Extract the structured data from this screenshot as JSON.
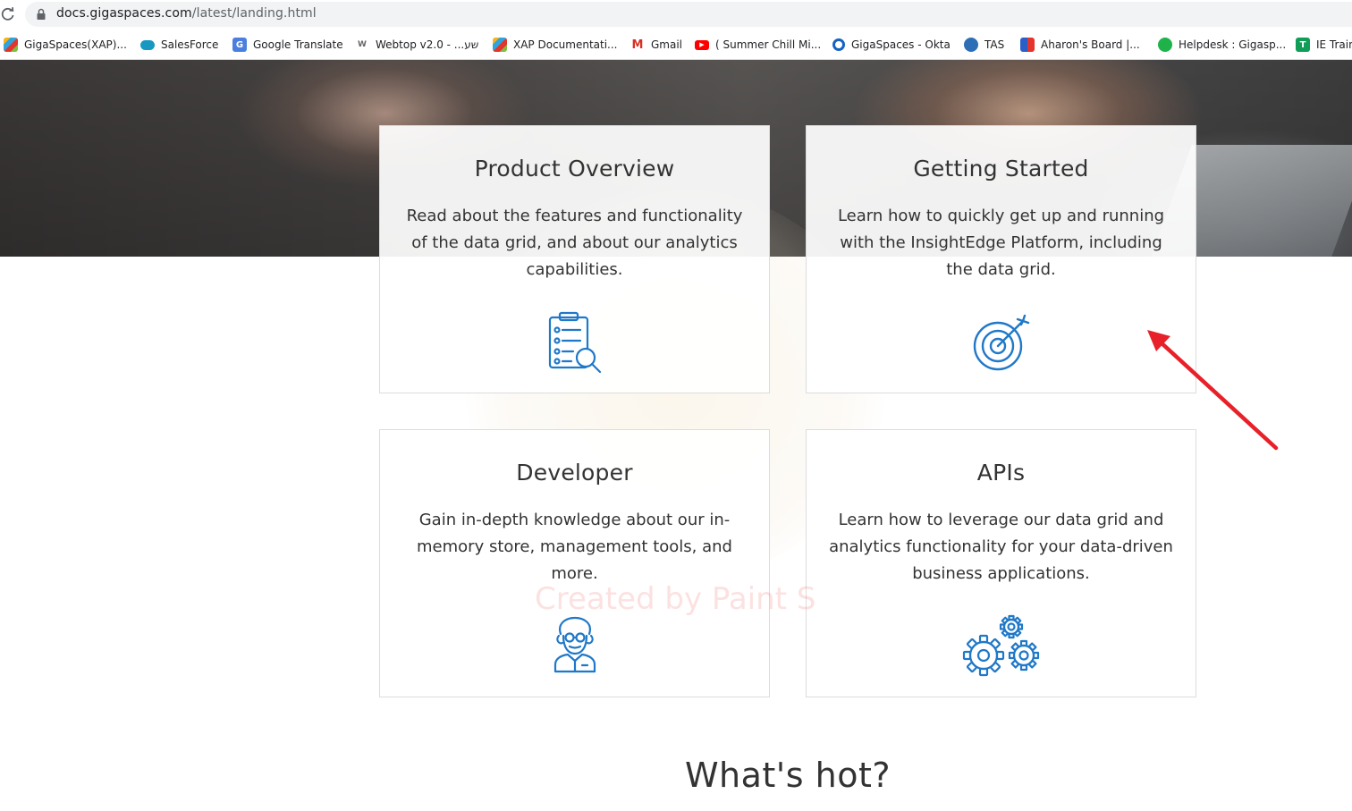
{
  "browser": {
    "url_host": "docs.gigaspaces.com",
    "url_path": "/latest/landing.html",
    "bookmarks": [
      {
        "label": "GigaSpaces(XAP)...",
        "icon": "gigaspaces-icon",
        "color": "#e5342b"
      },
      {
        "label": "SalesForce",
        "icon": "salesforce-cloud-icon",
        "color": "#1798c1"
      },
      {
        "label": "Google Translate",
        "icon": "google-translate-icon",
        "color": "#4a7fe0"
      },
      {
        "label": "Webtop v2.0 - ...שע",
        "icon": "webtop-icon",
        "color": "#777777"
      },
      {
        "label": "XAP Documentati...",
        "icon": "gigaspaces-icon",
        "color": "#e5342b"
      },
      {
        "label": "Gmail",
        "icon": "gmail-icon",
        "color": "#d93025"
      },
      {
        "label": "( Summer Chill Mi...",
        "icon": "youtube-icon",
        "color": "#ff0000"
      },
      {
        "label": "GigaSpaces - Okta",
        "icon": "okta-icon",
        "color": "#1662c4"
      },
      {
        "label": "TAS",
        "icon": "tas-icon",
        "color": "#2d6fb7"
      },
      {
        "label": "Aharon's Board |...",
        "icon": "board-icon",
        "color": "#c0392b"
      },
      {
        "label": "Helpdesk : Gigasp...",
        "icon": "helpdesk-icon",
        "color": "#20b24a"
      },
      {
        "label": "IE Train",
        "icon": "sheets-icon",
        "color": "#0f9d58"
      }
    ]
  },
  "cards": {
    "product_overview": {
      "title": "Product Overview",
      "description": "Read about the features and functionality of the data grid, and about our analytics capabilities.",
      "icon": "clipboard-search-icon"
    },
    "getting_started": {
      "title": "Getting Started",
      "description": "Learn how to quickly get up and running with the InsightEdge Platform, including the data grid.",
      "icon": "target-icon"
    },
    "developer": {
      "title": "Developer",
      "description": "Gain in-depth knowledge about our in-memory store, management tools, and more.",
      "icon": "scientist-icon"
    },
    "apis": {
      "title": "APIs",
      "description": "Learn how to leverage our data grid and analytics functionality for your data-driven business applications.",
      "icon": "gears-icon"
    }
  },
  "watermark": "Created by Paint S",
  "section_title": "What's hot?",
  "colors": {
    "icon_blue": "#1f78c8",
    "annotation_red": "#e8202a",
    "text": "#333333"
  }
}
